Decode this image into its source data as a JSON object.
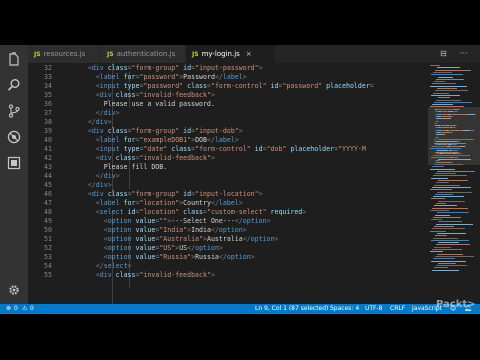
{
  "tabs": [
    {
      "icon": "JS",
      "label": "resources.js",
      "active": false
    },
    {
      "icon": "JS",
      "label": "authentication.js",
      "active": false
    },
    {
      "icon": "JS",
      "label": "my-login.js",
      "active": true,
      "close": "×"
    }
  ],
  "tab_actions": {
    "split": "⊟",
    "more": "···"
  },
  "code_lines": [
    {
      "num": "32",
      "indent": 6,
      "tokens": [
        [
          "p",
          "<"
        ],
        [
          "t",
          "div"
        ],
        [
          "a",
          " class"
        ],
        [
          "p",
          "="
        ],
        [
          "s",
          "\"form-group\""
        ],
        [
          "a",
          " id"
        ],
        [
          "p",
          "="
        ],
        [
          "s",
          "\"input-password\""
        ],
        [
          "p",
          ">"
        ]
      ]
    },
    {
      "num": "33",
      "indent": 8,
      "tokens": [
        [
          "p",
          "<"
        ],
        [
          "t",
          "label"
        ],
        [
          "a",
          " for"
        ],
        [
          "p",
          "="
        ],
        [
          "s",
          "\"password\""
        ],
        [
          "p",
          ">"
        ],
        [
          "x",
          "Password"
        ],
        [
          "p",
          "</"
        ],
        [
          "t",
          "label"
        ],
        [
          "p",
          ">"
        ]
      ]
    },
    {
      "num": "34",
      "indent": 8,
      "tokens": [
        [
          "p",
          "<"
        ],
        [
          "t",
          "input"
        ],
        [
          "a",
          " type"
        ],
        [
          "p",
          "="
        ],
        [
          "s",
          "\"password\""
        ],
        [
          "a",
          " class"
        ],
        [
          "p",
          "="
        ],
        [
          "s",
          "\"form-control\""
        ],
        [
          "a",
          " id"
        ],
        [
          "p",
          "="
        ],
        [
          "s",
          "\"password\""
        ],
        [
          "a",
          " placeholder"
        ],
        [
          "p",
          "="
        ]
      ]
    },
    {
      "num": "35",
      "indent": 8,
      "tokens": [
        [
          "p",
          "<"
        ],
        [
          "t",
          "div"
        ],
        [
          "a",
          " class"
        ],
        [
          "p",
          "="
        ],
        [
          "s",
          "\"invalid-feedback\""
        ],
        [
          "p",
          ">"
        ]
      ]
    },
    {
      "num": "36",
      "indent": 10,
      "tokens": [
        [
          "x",
          "Please use a valid password."
        ]
      ]
    },
    {
      "num": "37",
      "indent": 8,
      "tokens": [
        [
          "p",
          "</"
        ],
        [
          "t",
          "div"
        ],
        [
          "p",
          ">"
        ]
      ]
    },
    {
      "num": "38",
      "indent": 6,
      "tokens": [
        [
          "p",
          "</"
        ],
        [
          "t",
          "div"
        ],
        [
          "p",
          ">"
        ]
      ]
    },
    {
      "num": "39",
      "indent": 6,
      "tokens": [
        [
          "p",
          "<"
        ],
        [
          "t",
          "div"
        ],
        [
          "a",
          " class"
        ],
        [
          "p",
          "="
        ],
        [
          "s",
          "\"form-group\""
        ],
        [
          "a",
          " id"
        ],
        [
          "p",
          "="
        ],
        [
          "s",
          "\"input-dob\""
        ],
        [
          "p",
          ">"
        ]
      ]
    },
    {
      "num": "40",
      "indent": 8,
      "tokens": [
        [
          "p",
          "<"
        ],
        [
          "t",
          "label"
        ],
        [
          "a",
          " for"
        ],
        [
          "p",
          "="
        ],
        [
          "s",
          "\"exampleDOB1\""
        ],
        [
          "p",
          ">"
        ],
        [
          "x",
          "DOB"
        ],
        [
          "p",
          "</"
        ],
        [
          "t",
          "label"
        ],
        [
          "p",
          ">"
        ]
      ]
    },
    {
      "num": "41",
      "indent": 8,
      "tokens": [
        [
          "p",
          "<"
        ],
        [
          "t",
          "input"
        ],
        [
          "a",
          " type"
        ],
        [
          "p",
          "="
        ],
        [
          "s",
          "\"date\""
        ],
        [
          "a",
          " class"
        ],
        [
          "p",
          "="
        ],
        [
          "s",
          "\"form-control\""
        ],
        [
          "a",
          " id"
        ],
        [
          "p",
          "="
        ],
        [
          "s",
          "\"dob\""
        ],
        [
          "a",
          " placeholder"
        ],
        [
          "p",
          "="
        ],
        [
          "s",
          "\"YYYY-M"
        ]
      ]
    },
    {
      "num": "42",
      "indent": 8,
      "tokens": [
        [
          "p",
          "<"
        ],
        [
          "t",
          "div"
        ],
        [
          "a",
          " class"
        ],
        [
          "p",
          "="
        ],
        [
          "s",
          "\"invalid-feedback\""
        ],
        [
          "p",
          ">"
        ]
      ]
    },
    {
      "num": "43",
      "indent": 10,
      "tokens": [
        [
          "x",
          "Please fill DOB."
        ]
      ]
    },
    {
      "num": "44",
      "indent": 8,
      "tokens": [
        [
          "p",
          "</"
        ],
        [
          "t",
          "div"
        ],
        [
          "p",
          ">"
        ]
      ]
    },
    {
      "num": "45",
      "indent": 6,
      "tokens": [
        [
          "p",
          "</"
        ],
        [
          "t",
          "div"
        ],
        [
          "p",
          ">"
        ]
      ]
    },
    {
      "num": "46",
      "indent": 6,
      "tokens": [
        [
          "p",
          "<"
        ],
        [
          "t",
          "div"
        ],
        [
          "a",
          " class"
        ],
        [
          "p",
          "="
        ],
        [
          "s",
          "\"form-group\""
        ],
        [
          "a",
          " id"
        ],
        [
          "p",
          "="
        ],
        [
          "s",
          "\"input-location\""
        ],
        [
          "p",
          ">"
        ]
      ]
    },
    {
      "num": "47",
      "indent": 8,
      "tokens": [
        [
          "p",
          "<"
        ],
        [
          "t",
          "label"
        ],
        [
          "a",
          " for"
        ],
        [
          "p",
          "="
        ],
        [
          "s",
          "\"location\""
        ],
        [
          "p",
          ">"
        ],
        [
          "x",
          "Country"
        ],
        [
          "p",
          "</"
        ],
        [
          "t",
          "label"
        ],
        [
          "p",
          ">"
        ]
      ]
    },
    {
      "num": "48",
      "indent": 8,
      "tokens": [
        [
          "p",
          "<"
        ],
        [
          "t",
          "select"
        ],
        [
          "a",
          " id"
        ],
        [
          "p",
          "="
        ],
        [
          "s",
          "\"location\""
        ],
        [
          "a",
          " class"
        ],
        [
          "p",
          "="
        ],
        [
          "s",
          "\"custom-select\""
        ],
        [
          "a",
          " required"
        ],
        [
          "p",
          ">"
        ]
      ]
    },
    {
      "num": "49",
      "indent": 10,
      "tokens": [
        [
          "p",
          "<"
        ],
        [
          "t",
          "option"
        ],
        [
          "a",
          " value"
        ],
        [
          "p",
          "="
        ],
        [
          "s",
          "\"\""
        ],
        [
          "p",
          ">"
        ],
        [
          "x",
          "---Select One---"
        ],
        [
          "p",
          "</"
        ],
        [
          "t",
          "option"
        ],
        [
          "p",
          ">"
        ]
      ]
    },
    {
      "num": "50",
      "indent": 10,
      "tokens": [
        [
          "p",
          "<"
        ],
        [
          "t",
          "option"
        ],
        [
          "a",
          " value"
        ],
        [
          "p",
          "="
        ],
        [
          "s",
          "\"India\""
        ],
        [
          "p",
          ">"
        ],
        [
          "x",
          "India"
        ],
        [
          "p",
          "</"
        ],
        [
          "t",
          "option"
        ],
        [
          "p",
          ">"
        ]
      ]
    },
    {
      "num": "51",
      "indent": 10,
      "tokens": [
        [
          "p",
          "<"
        ],
        [
          "t",
          "option"
        ],
        [
          "a",
          " value"
        ],
        [
          "p",
          "="
        ],
        [
          "s",
          "\"Australia\""
        ],
        [
          "p",
          ">"
        ],
        [
          "x",
          "Australia"
        ],
        [
          "p",
          "</"
        ],
        [
          "t",
          "option"
        ],
        [
          "p",
          ">"
        ]
      ]
    },
    {
      "num": "52",
      "indent": 10,
      "tokens": [
        [
          "p",
          "<"
        ],
        [
          "t",
          "option"
        ],
        [
          "a",
          " value"
        ],
        [
          "p",
          "="
        ],
        [
          "s",
          "\"US\""
        ],
        [
          "p",
          ">"
        ],
        [
          "x",
          "US"
        ],
        [
          "p",
          "</"
        ],
        [
          "t",
          "option"
        ],
        [
          "p",
          ">"
        ]
      ]
    },
    {
      "num": "53",
      "indent": 10,
      "tokens": [
        [
          "p",
          "<"
        ],
        [
          "t",
          "option"
        ],
        [
          "a",
          " value"
        ],
        [
          "p",
          "="
        ],
        [
          "s",
          "\"Russia\""
        ],
        [
          "p",
          ">"
        ],
        [
          "x",
          "Russia"
        ],
        [
          "p",
          "</"
        ],
        [
          "t",
          "option"
        ],
        [
          "p",
          ">"
        ]
      ]
    },
    {
      "num": "54",
      "indent": 8,
      "tokens": [
        [
          "p",
          "</"
        ],
        [
          "t",
          "select"
        ],
        [
          "p",
          ">"
        ]
      ]
    },
    {
      "num": "55",
      "indent": 8,
      "tokens": [
        [
          "p",
          "<"
        ],
        [
          "t",
          "div"
        ],
        [
          "a",
          " class"
        ],
        [
          "p",
          "="
        ],
        [
          "s",
          "\"invalid-feedback\""
        ],
        [
          "p",
          ">"
        ]
      ]
    }
  ],
  "activity_bar": {
    "top": [
      "files-icon",
      "search-icon",
      "source-control-icon",
      "debug-icon",
      "extensions-icon"
    ],
    "bottom": [
      "settings-icon"
    ]
  },
  "status": {
    "errors": "0",
    "warnings": "0",
    "position": "Ln 9, Col 1 (87 selected)",
    "spaces": "Spaces: 4",
    "encoding": "UTF-8",
    "eol": "CRLF",
    "language": "JavaScript"
  },
  "watermark": "Packt>",
  "colors": {
    "background": "#1e1e1e",
    "activity_bar": "#333333",
    "status_bar": "#007acc",
    "tag": "#569cd6",
    "attribute": "#9cdcfe",
    "string": "#ce9178",
    "text": "#d4d4d4",
    "js_badge": "#cbcb41"
  }
}
